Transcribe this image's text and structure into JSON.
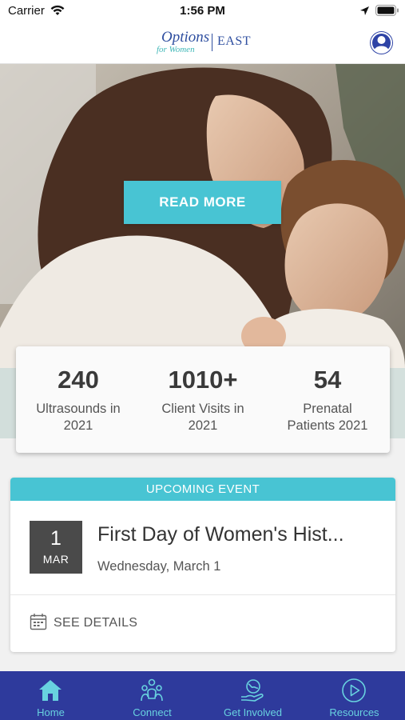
{
  "status_bar": {
    "carrier": "Carrier",
    "time": "1:56 PM",
    "wifi_icon": "wifi-icon",
    "location_icon": "location-arrow-icon",
    "battery_icon": "battery-icon"
  },
  "header": {
    "logo_word": "Options",
    "logo_tagline": "for Women",
    "logo_branch": "EAST",
    "profile_icon": "user-profile-icon"
  },
  "hero": {
    "button_label": "READ MORE"
  },
  "stats": [
    {
      "value": "240",
      "label_line1": "Ultrasounds in",
      "label_line2": "2021"
    },
    {
      "value": "1010+",
      "label_line1": "Client Visits in",
      "label_line2": "2021"
    },
    {
      "value": "54",
      "label_line1": "Prenatal",
      "label_line2": "Patients 2021"
    }
  ],
  "event": {
    "header": "UPCOMING EVENT",
    "day": "1",
    "month": "MAR",
    "title": "First Day of Women's Hist...",
    "date": "Wednesday, March 1",
    "details_label": "SEE DETAILS",
    "details_icon": "calendar-icon"
  },
  "tabs": [
    {
      "label": "Home",
      "icon": "home-icon"
    },
    {
      "label": "Connect",
      "icon": "people-icon"
    },
    {
      "label": "Get Involved",
      "icon": "globe-hand-icon"
    },
    {
      "label": "Resources",
      "icon": "play-circle-icon"
    }
  ],
  "colors": {
    "accent": "#48c4d3",
    "tab_bar": "#2e3a9c",
    "tab_label": "#68d2df",
    "brand_blue": "#2f4fa0"
  }
}
